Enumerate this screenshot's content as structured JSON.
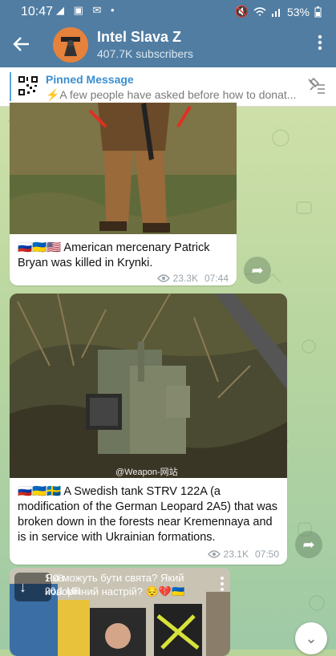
{
  "status": {
    "time": "10:47",
    "battery": "53%"
  },
  "header": {
    "back_icon": "arrow-left-icon",
    "title": "Intel Slava Z",
    "subtitle": "407.7K subscribers",
    "menu_icon": "more-vert-icon"
  },
  "pinned": {
    "title": "Pinned Message",
    "text": "⚡A few people have asked before how to donat..."
  },
  "messages": [
    {
      "caption": "🇷🇺🇺🇦🇺🇸 American mercenary Patrick Bryan was killed in Krynki.",
      "views": "23.3K",
      "time": "07:44"
    },
    {
      "watermark": "@Weapon-网站",
      "caption": "🇷🇺🇺🇦🇸🇪 A Swedish tank STRV 122A (a modification of the German Leopard 2A5) that was broken down in the forests near Kremennaya and is in service with Ukrainian formations.",
      "views": "23.1K",
      "time": "07:50"
    },
    {
      "video_duration": "1:08",
      "video_size": "20,1 MB",
      "overlay_text": "Які можуть бути свята? Який новорічний настрій? 😔💔🇺🇦"
    }
  ],
  "colors": {
    "header": "#517da2",
    "accent": "#3a8ed0"
  }
}
